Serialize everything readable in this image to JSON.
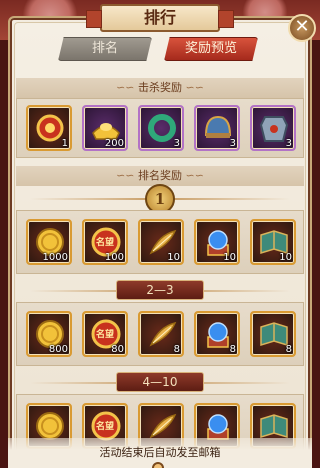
{
  "window": {
    "title": "排行",
    "close_icon": "close-icon"
  },
  "tabs": [
    {
      "label": "排名",
      "active": false
    },
    {
      "label": "奖励预览",
      "active": true
    }
  ],
  "kill_rewards": {
    "header": "击杀奖励",
    "items": [
      {
        "icon": "red-gem-badge-icon",
        "count": "1",
        "frame": "gold"
      },
      {
        "icon": "gold-ingot-icon",
        "count": "200",
        "frame": "purple"
      },
      {
        "icon": "jade-ring-icon",
        "count": "3",
        "frame": "purple"
      },
      {
        "icon": "helmet-icon",
        "count": "3",
        "frame": "purple"
      },
      {
        "icon": "armor-icon",
        "count": "3",
        "frame": "purple"
      }
    ]
  },
  "rank_rewards": {
    "header": "排名奖励",
    "tiers": [
      {
        "rank": "1",
        "items": [
          {
            "icon": "gold-coin-icon",
            "count": "1000",
            "frame": "gold"
          },
          {
            "icon": "fame-badge-icon",
            "badge_text": "名望",
            "count": "100",
            "frame": "gold"
          },
          {
            "icon": "feather-icon",
            "count": "10",
            "frame": "gold"
          },
          {
            "icon": "blue-orb-icon",
            "count": "10",
            "frame": "gold"
          },
          {
            "icon": "skill-book-icon",
            "count": "10",
            "frame": "gold"
          }
        ]
      },
      {
        "rank": "2—3",
        "items": [
          {
            "icon": "gold-coin-icon",
            "count": "800",
            "frame": "gold"
          },
          {
            "icon": "fame-badge-icon",
            "badge_text": "名望",
            "count": "80",
            "frame": "gold"
          },
          {
            "icon": "feather-icon",
            "count": "8",
            "frame": "gold"
          },
          {
            "icon": "blue-orb-icon",
            "count": "8",
            "frame": "gold"
          },
          {
            "icon": "skill-book-icon",
            "count": "8",
            "frame": "gold"
          }
        ]
      },
      {
        "rank": "4—10",
        "items": [
          {
            "icon": "gold-coin-icon",
            "count": "",
            "frame": "gold"
          },
          {
            "icon": "fame-badge-icon",
            "badge_text": "名望",
            "count": "",
            "frame": "gold"
          },
          {
            "icon": "feather-icon",
            "count": "",
            "frame": "gold"
          },
          {
            "icon": "blue-orb-icon",
            "count": "",
            "frame": "gold"
          },
          {
            "icon": "skill-book-icon",
            "count": "",
            "frame": "gold"
          }
        ]
      }
    ]
  },
  "footer": {
    "text": "活动结束后自动发至邮箱"
  },
  "colors": {
    "accent": "#a52a1c",
    "panel": "#f3ece0",
    "gold": "#d99a32"
  }
}
